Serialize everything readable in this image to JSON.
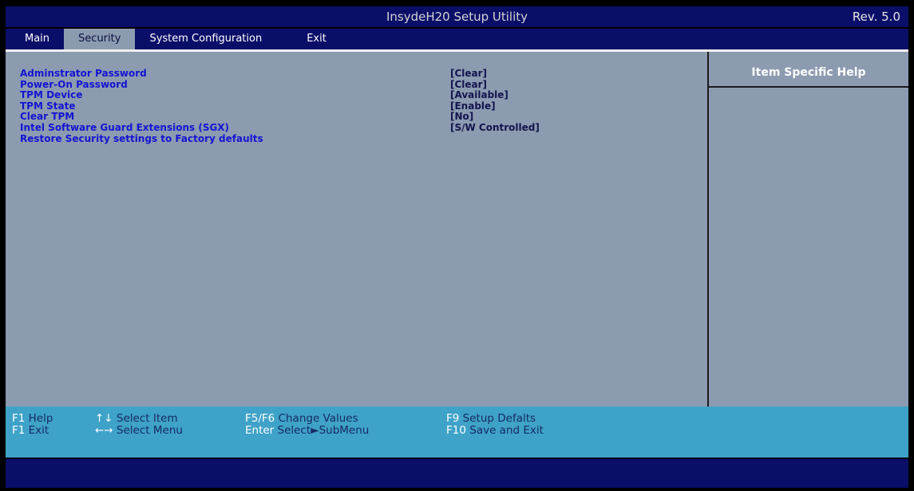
{
  "window": {
    "title": "InsydeH20 Setup Utility",
    "revision": "Rev. 5.0"
  },
  "tabs": [
    {
      "label": "Main",
      "selected": false
    },
    {
      "label": "Security",
      "selected": true
    },
    {
      "label": "System Configuration",
      "selected": false
    },
    {
      "label": "Exit",
      "selected": false
    }
  ],
  "settings": [
    {
      "label": "Adminstrator Password",
      "value": "[Clear]"
    },
    {
      "label": "Power-On Password",
      "value": "[Clear]"
    },
    {
      "label": "TPM Device",
      "value": "[Available]"
    },
    {
      "label": "TPM State",
      "value": "[Enable]"
    },
    {
      "label": "Clear TPM",
      "value": "[No]"
    },
    {
      "label": "Intel Software Guard Extensions (SGX)",
      "value": "[S/W Controlled]"
    },
    {
      "label": "Restore Security settings to Factory defaults",
      "value": ""
    }
  ],
  "help_panel": {
    "title": "Item Specific Help",
    "body": ""
  },
  "footer": {
    "rows": [
      [
        {
          "key": "F1",
          "label": "Help"
        },
        {
          "key": "↑↓",
          "label": "Select Item"
        },
        {
          "key": "F5/F6",
          "label": "Change Values"
        },
        {
          "key": "F9",
          "label": "Setup Defalts"
        }
      ],
      [
        {
          "key": "F1",
          "label": "Exit"
        },
        {
          "key": "←→",
          "label": "Select Menu"
        },
        {
          "key": "Enter",
          "label": "Select►SubMenu"
        },
        {
          "key": "F10",
          "label": "Save and Exit"
        }
      ]
    ]
  },
  "colors": {
    "titlebar_navy": "#0a0e68",
    "content_gray_blue": "#8c9bb0",
    "setting_label_blue": "#1414d2",
    "setting_value_navy": "#13134e",
    "footer_teal": "#3fa2c8",
    "footer_key_white": "#ffffff",
    "footer_hint_navy": "#152a66",
    "help_title_white": "#ffffff"
  }
}
